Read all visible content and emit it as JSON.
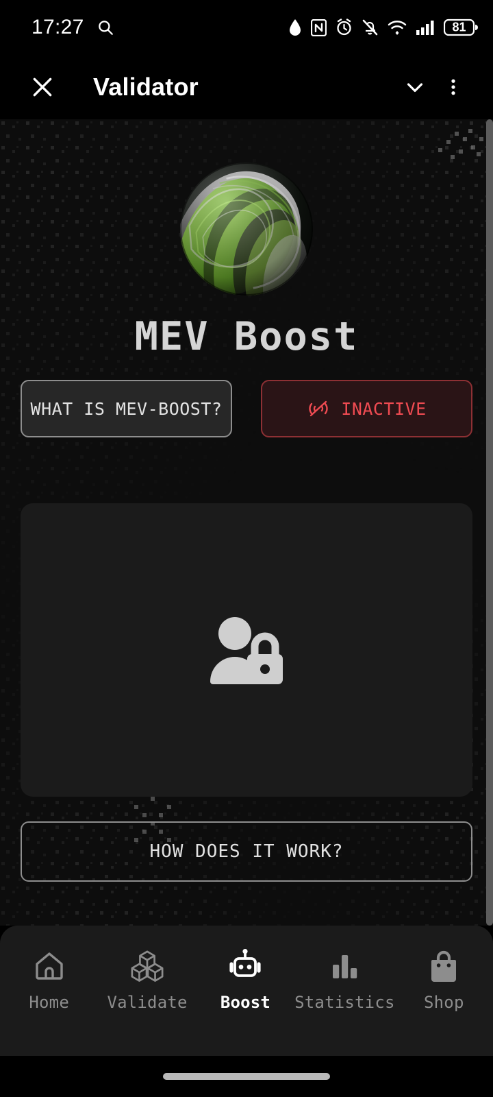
{
  "status_bar": {
    "time": "17:27",
    "battery_level": "81",
    "icons": [
      "search-icon",
      "water-drop-icon",
      "nfc-icon",
      "alarm-icon",
      "bell-muted-icon",
      "wifi-icon",
      "cellular-signal-icon",
      "battery-icon"
    ]
  },
  "app_bar": {
    "close_label": "×",
    "title": "Validator",
    "icons": [
      "close-icon",
      "chevron-down-icon",
      "overflow-menu-icon"
    ]
  },
  "hero": {
    "logo_alt": "mev-boost-sphere-logo",
    "title": "MEV Boost"
  },
  "actions": {
    "what_is_label": "WHAT IS MEV-BOOST?",
    "status_label": "INACTIVE",
    "status_icon": "signal-off-icon",
    "how_it_works_label": "HOW DOES IT WORK?"
  },
  "card": {
    "icon": "user-locked-icon",
    "empty": true
  },
  "bottom_nav": {
    "active": "Boost",
    "items": [
      {
        "label": "Home",
        "icon": "home-icon"
      },
      {
        "label": "Validate",
        "icon": "cubes-icon"
      },
      {
        "label": "Boost",
        "icon": "robot-icon"
      },
      {
        "label": "Statistics",
        "icon": "bar-chart-icon"
      },
      {
        "label": "Shop",
        "icon": "shopping-bag-icon"
      }
    ]
  },
  "colors": {
    "background": "#0d0d0d",
    "card": "#1b1b1b",
    "accent_red": "#ef4b52",
    "accent_green": "#7ab648",
    "text_primary": "#e2e2e2",
    "text_muted": "#8d8d8d"
  }
}
